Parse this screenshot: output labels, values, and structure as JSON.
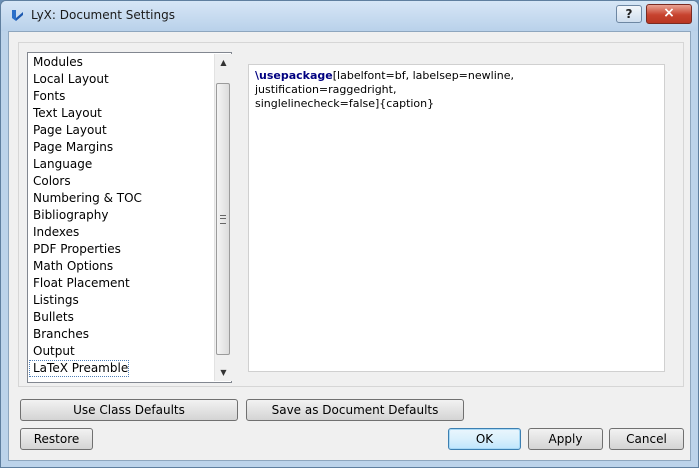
{
  "window": {
    "title": "LyX: Document Settings",
    "help_label": "?",
    "close_label": "×"
  },
  "sidebar": {
    "items": [
      "Modules",
      "Local Layout",
      "Fonts",
      "Text Layout",
      "Page Layout",
      "Page Margins",
      "Language",
      "Colors",
      "Numbering & TOC",
      "Bibliography",
      "Indexes",
      "PDF Properties",
      "Math Options",
      "Float Placement",
      "Listings",
      "Bullets",
      "Branches",
      "Output",
      "LaTeX Preamble"
    ],
    "selected": "LaTeX Preamble"
  },
  "editor": {
    "command": "\\usepackage",
    "line1_rest": "[labelfont=bf, labelsep=newline, justification=raggedright,",
    "line2": "singlelinecheck=false]{caption}"
  },
  "buttons": {
    "use_class_defaults": "Use Class Defaults",
    "save_as_defaults": "Save as Document Defaults",
    "restore": "Restore",
    "ok": "OK",
    "apply": "Apply",
    "cancel": "Cancel"
  },
  "icons": {
    "app": "lyx-logo-icon",
    "scroll_up": "arrow-up-icon",
    "scroll_down": "arrow-down-icon"
  },
  "colors": {
    "latex_command": "#000080",
    "close_button": "#c7432f"
  }
}
